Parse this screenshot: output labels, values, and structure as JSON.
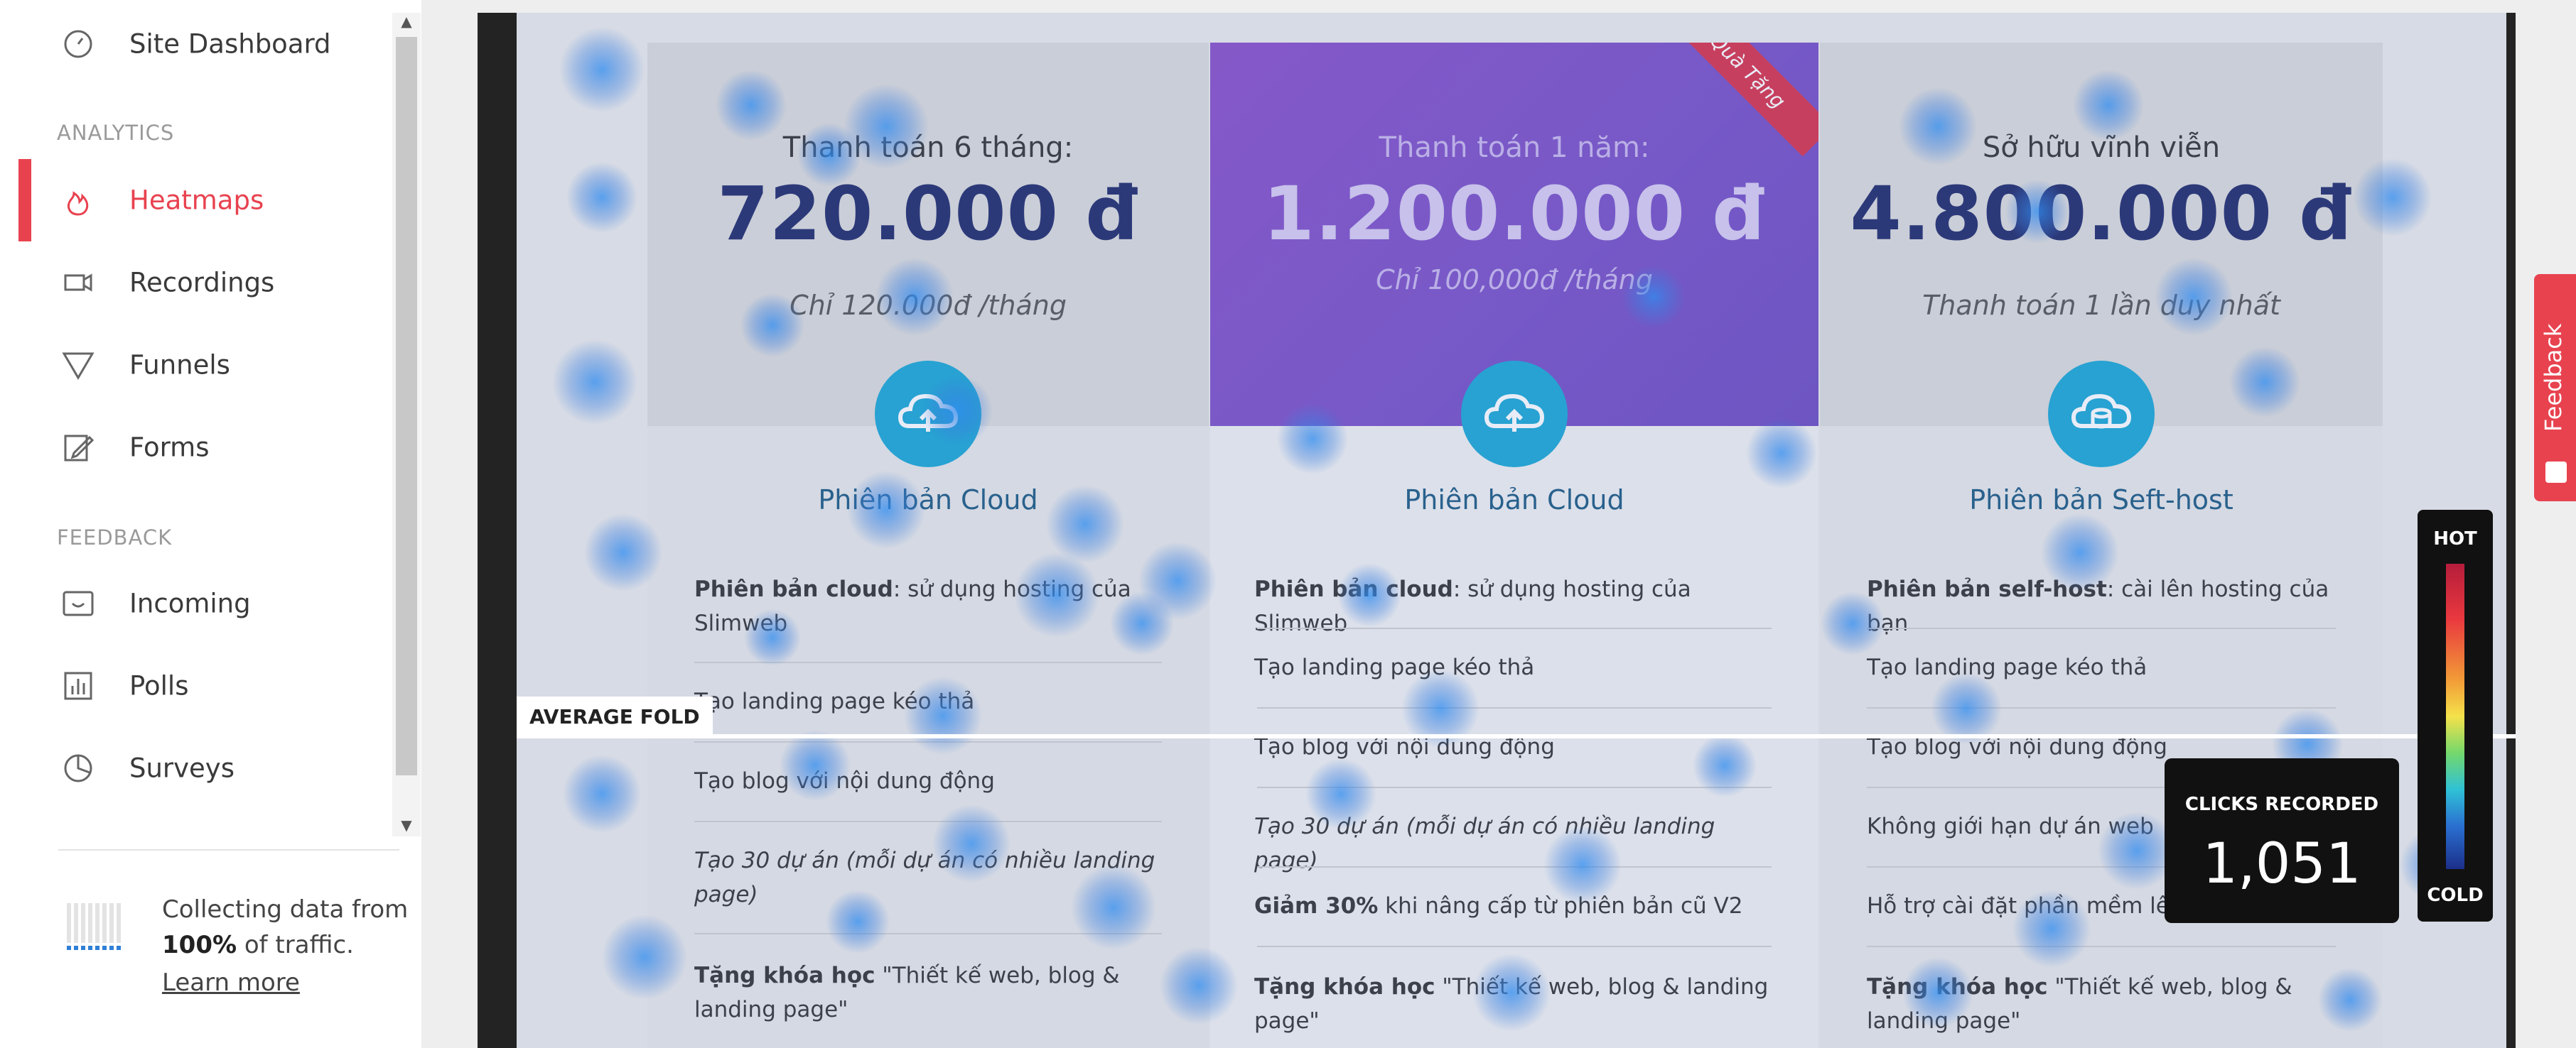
{
  "sidebar": {
    "items": [
      {
        "label": "Site Dashboard",
        "icon": "dashboard-icon"
      },
      {
        "label": "Heatmaps",
        "icon": "flame-icon",
        "active": true
      },
      {
        "label": "Recordings",
        "icon": "video-camera-icon"
      },
      {
        "label": "Funnels",
        "icon": "funnel-icon"
      },
      {
        "label": "Forms",
        "icon": "edit-form-icon"
      },
      {
        "label": "Incoming",
        "icon": "inbox-smile-icon"
      },
      {
        "label": "Polls",
        "icon": "bar-chart-icon"
      },
      {
        "label": "Surveys",
        "icon": "pie-chart-icon"
      }
    ],
    "sections": {
      "analytics": "ANALYTICS",
      "feedback": "FEEDBACK"
    },
    "footer": {
      "line1": "Collecting data from",
      "percent": "100%",
      "line2_suffix": " of traffic.",
      "learn_more": "Learn more"
    }
  },
  "heatmap": {
    "fold_label": "AVERAGE FOLD",
    "clicks_label": "CLICKS RECORDED",
    "clicks_value": "1,051",
    "legend_hot": "HOT",
    "legend_cold": "COLD"
  },
  "pricing": {
    "ribbon": "Quà Tặng",
    "columns": [
      {
        "pay_label": "Thanh toán 6 tháng:",
        "price": "720.000 đ",
        "sub": "Chỉ 120.000đ /tháng",
        "edition": "Phiên bản Cloud",
        "features": [
          {
            "bold": "Phiên bản cloud",
            "text": ": sử dụng hosting của Slimweb"
          },
          {
            "bold": "",
            "text": "Tạo landing page kéo thả"
          },
          {
            "bold": "",
            "text": "Tạo blog với nội dung động"
          },
          {
            "bold": "",
            "text": "Tạo 30 dự án (mỗi dự án có nhiều landing page)"
          },
          {
            "bold": "Tặng khóa học",
            "text": " \"Thiết kế web, blog & landing page\""
          }
        ]
      },
      {
        "pay_label": "Thanh toán 1 năm:",
        "price": "1.200.000 đ",
        "sub": "Chỉ 100,000đ /tháng",
        "edition": "Phiên bản Cloud",
        "features": [
          {
            "bold": "Phiên bản cloud",
            "text": ": sử dụng hosting của Slimweb"
          },
          {
            "bold": "",
            "text": "Tạo landing page kéo thả"
          },
          {
            "bold": "",
            "text": "Tạo blog với nội dung động"
          },
          {
            "bold": "",
            "text": "Tạo 30 dự án (mỗi dự án có nhiều landing page)"
          },
          {
            "bold": "Giảm 30%",
            "text": " khi nâng cấp từ phiên bản cũ V2"
          },
          {
            "bold": "Tặng khóa học",
            "text": " \"Thiết kế web, blog & landing page\""
          }
        ]
      },
      {
        "pay_label": "Sở hữu vĩnh viễn",
        "price": "4.800.000 đ",
        "sub": "Thanh toán 1 lần duy nhất",
        "edition": "Phiên bản Seft-host",
        "features": [
          {
            "bold": "Phiên bản self-host",
            "text": ": cài lên hosting của bạn"
          },
          {
            "bold": "",
            "text": "Tạo landing page kéo thả"
          },
          {
            "bold": "",
            "text": "Tạo blog với nội dung động"
          },
          {
            "bold": "",
            "text": "Không giới hạn dự án web"
          },
          {
            "bold": "",
            "text": "Hỗ trợ cài đặt phần mềm lên hosting"
          },
          {
            "bold": "Tặng khóa học",
            "text": " \"Thiết kế web, blog & landing page\""
          }
        ]
      }
    ]
  },
  "feedback_tab": {
    "label": "Feedback"
  },
  "colors": {
    "accent": "#e8424f",
    "price": "#1f2a6b",
    "premium": "#7a50c8"
  }
}
